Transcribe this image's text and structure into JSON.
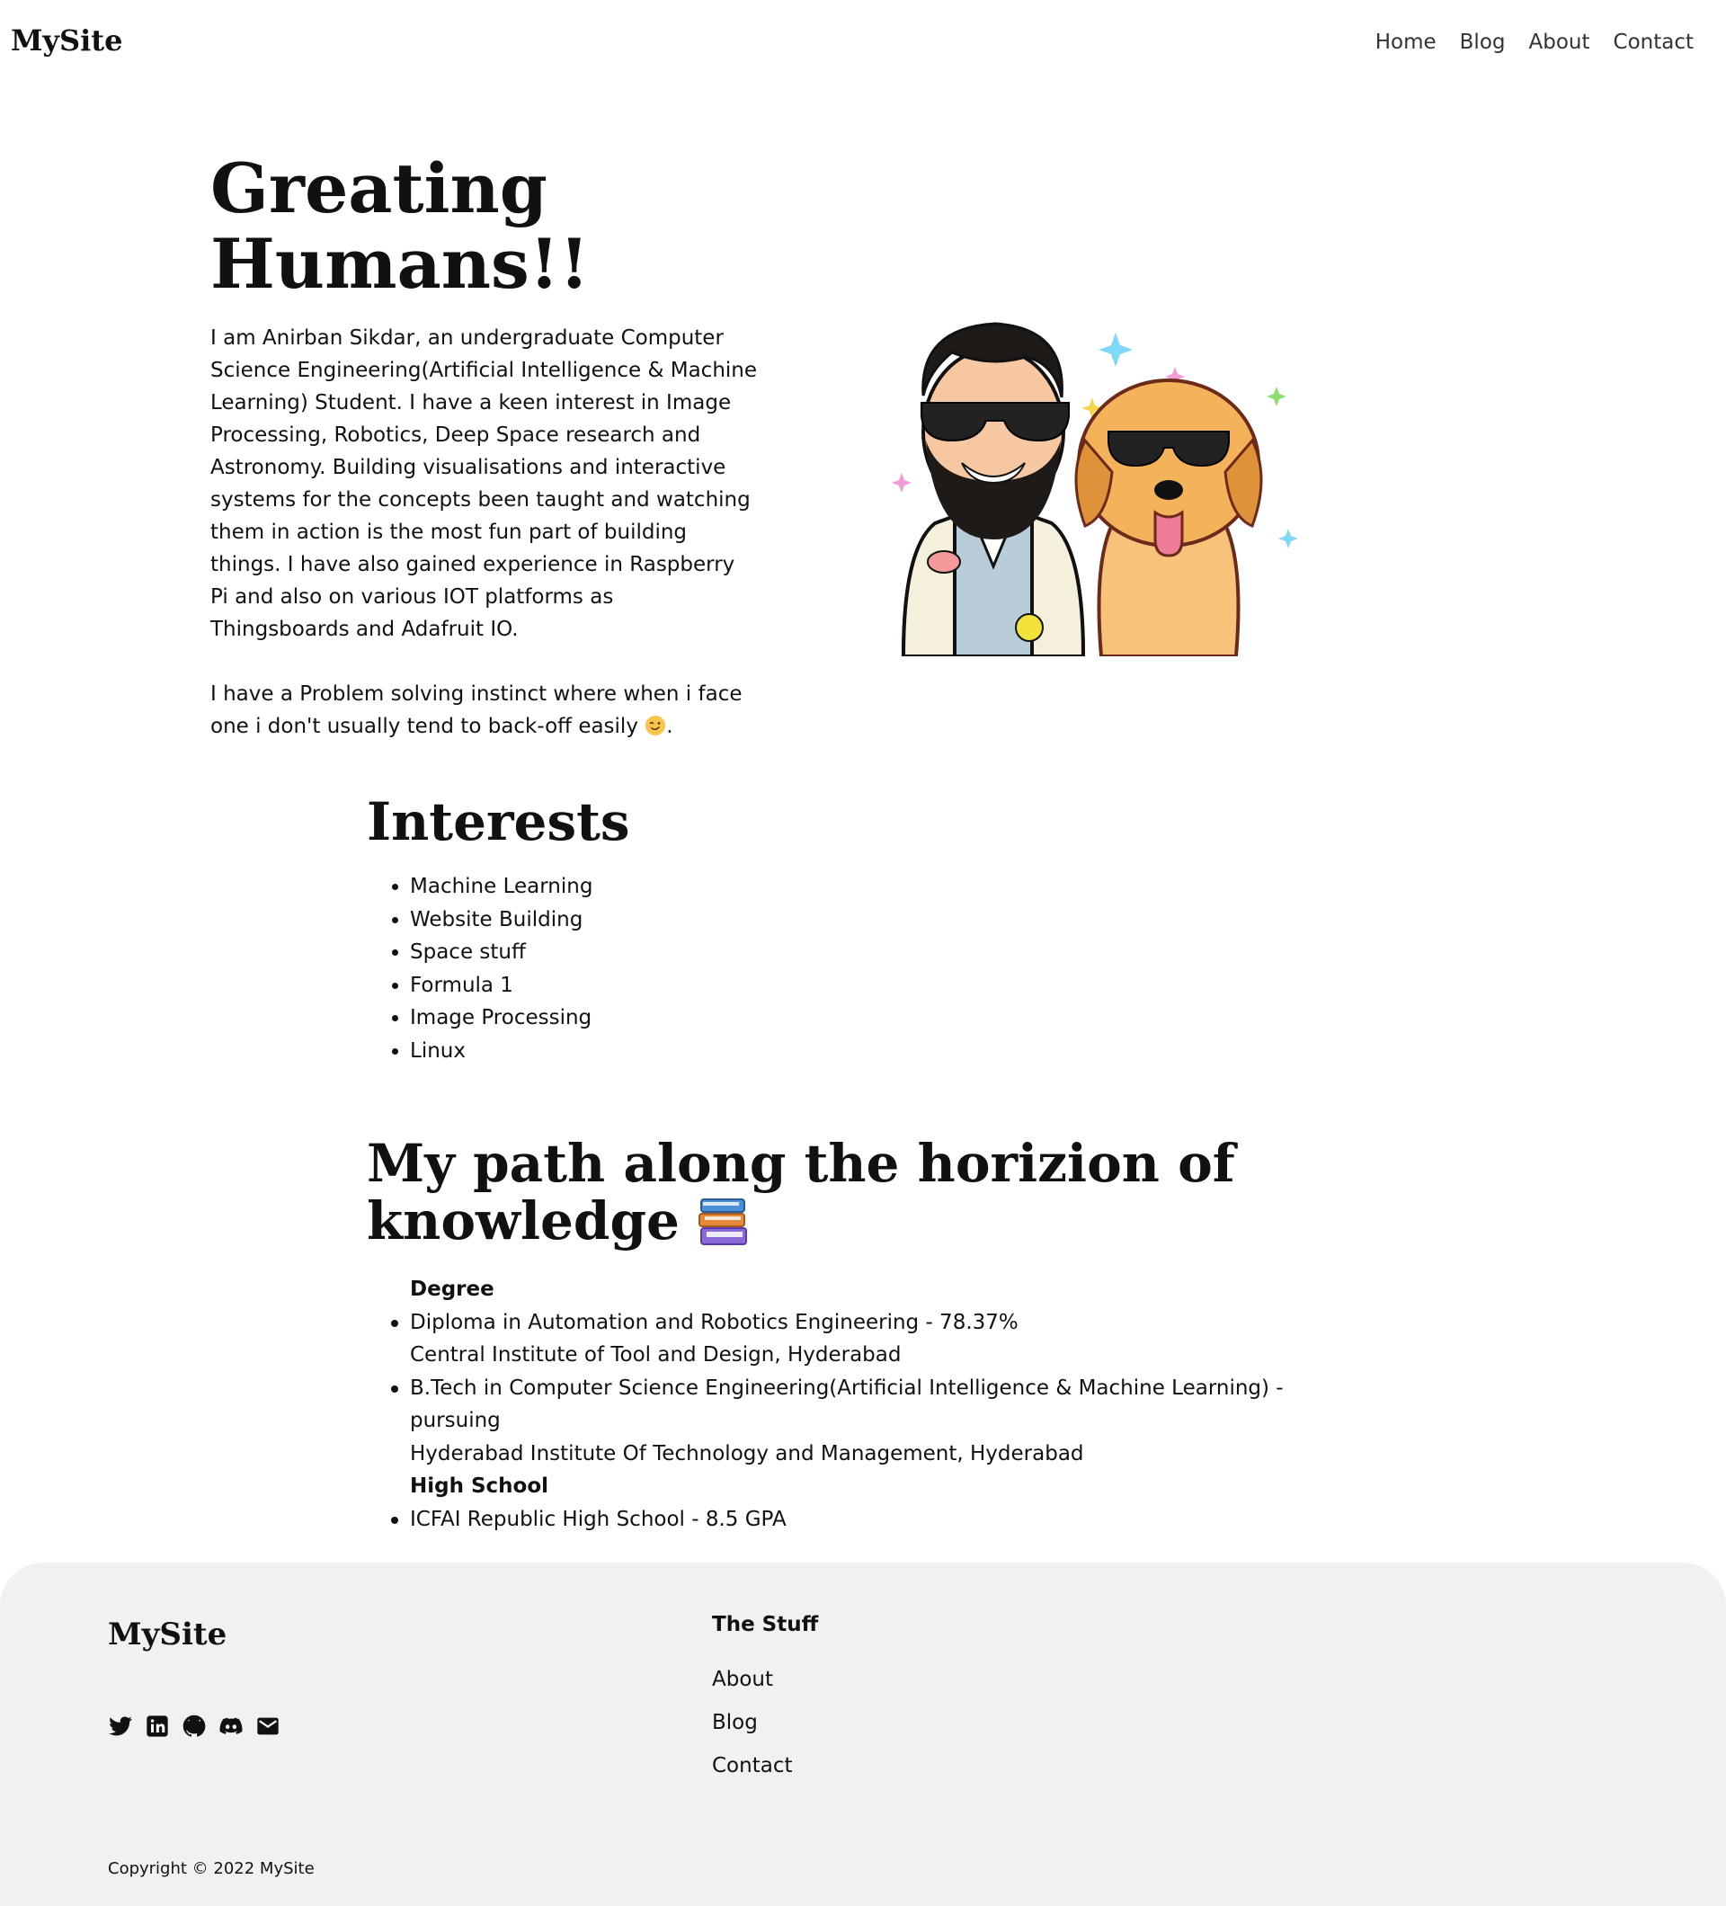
{
  "nav": {
    "brand": "MySite",
    "links": [
      "Home",
      "Blog",
      "About",
      "Contact"
    ]
  },
  "hero": {
    "title": "Greating Humans!!",
    "para1": "I am Anirban Sikdar, an undergraduate Computer Science Engineering(Artificial Intelligence & Machine Learning) Student. I have a keen interest in Image Processing, Robotics, Deep Space research and Astronomy. Building visualisations and interactive systems for the concepts been taught and watching them in action is the most fun part of building things. I have also gained experience in Raspberry Pi and also on various IOT platforms as Thingsboards and Adafruit IO.",
    "para2": "I have a Problem solving instinct where when i face one i don't usually tend to back-off easily",
    "para2_end": ".",
    "emoji": "winking-face"
  },
  "interests": {
    "title": "Interests",
    "items": [
      "Machine Learning",
      "Website Building",
      "Space stuff",
      "Formula 1",
      "Image Processing",
      "Linux"
    ]
  },
  "path": {
    "title": "My path along the horizion of knowledge",
    "emoji": "books-icon",
    "degree_label": "Degree",
    "items": [
      {
        "line1": "Diploma in Automation and Robotics Engineering - 78.37%",
        "line2": "Central Institute of Tool and Design, Hyderabad"
      },
      {
        "line1": "B.Tech in Computer Science Engineering(Artificial Intelligence & Machine Learning) - pursuing",
        "line2": "Hyderabad Institute Of Technology and Management, Hyderabad"
      }
    ],
    "school_label": "High School",
    "school_item": "ICFAI Republic High School - 8.5 GPA"
  },
  "footer": {
    "brand": "MySite",
    "col_title": "The Stuff",
    "links": [
      "About",
      "Blog",
      "Contact"
    ],
    "social_icons": [
      "twitter-icon",
      "linkedin-icon",
      "github-icon",
      "discord-icon",
      "mail-icon"
    ],
    "copyright": "Copyright © 2022 MySite"
  },
  "colors": {
    "footer_bg": "#f1f1f1",
    "text": "#111111",
    "nav_link": "#333333"
  }
}
